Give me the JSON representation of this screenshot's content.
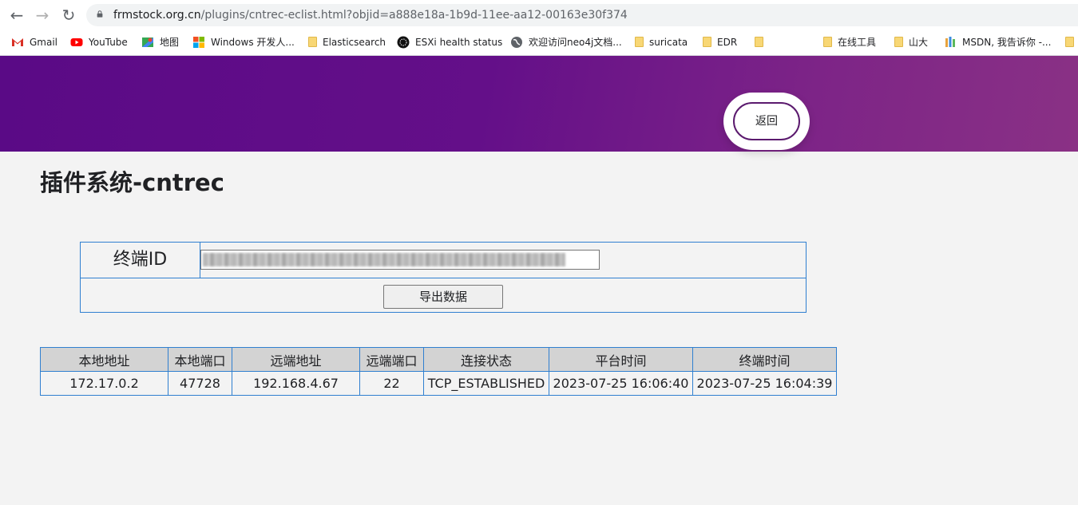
{
  "browser": {
    "url_host": "frmstock.org.cn",
    "url_path": "/plugins/cntrec-eclist.html?objid=a888e18a-1b9d-11ee-aa12-00163e30f374",
    "bookmarks": [
      {
        "label": "Gmail",
        "icon": "gmail-icon"
      },
      {
        "label": "YouTube",
        "icon": "youtube-icon"
      },
      {
        "label": "地图",
        "icon": "maps-icon"
      },
      {
        "label": "Windows 开发人...",
        "icon": "windows-icon"
      },
      {
        "label": "Elasticsearch",
        "icon": "folder-icon"
      },
      {
        "label": "ESXi health status",
        "icon": "esxi-icon"
      },
      {
        "label": "欢迎访问neo4j文档...",
        "icon": "globe-icon"
      },
      {
        "label": "suricata",
        "icon": "folder-icon"
      },
      {
        "label": "EDR",
        "icon": "folder-icon"
      },
      {
        "label": "",
        "icon": "folder-icon"
      },
      {
        "label": "在线工具",
        "icon": "folder-icon"
      },
      {
        "label": "山大",
        "icon": "folder-icon"
      },
      {
        "label": "MSDN, 我告诉你 -...",
        "icon": "msdn-icon"
      },
      {
        "label": "",
        "icon": "folder-icon"
      }
    ]
  },
  "header": {
    "back_label": "返回",
    "gradient_colors": [
      "#5a0a86",
      "#8a3185"
    ]
  },
  "page": {
    "title": "插件系统-cntrec"
  },
  "form": {
    "id_label": "终端ID",
    "id_value": "",
    "export_label": "导出数据"
  },
  "table": {
    "headers": [
      "本地地址",
      "本地端口",
      "远端地址",
      "远端端口",
      "连接状态",
      "平台时间",
      "终端时间"
    ],
    "rows": [
      [
        "172.17.0.2",
        "47728",
        "192.168.4.67",
        "22",
        "TCP_ESTABLISHED",
        "2023-07-25 16:06:40",
        "2023-07-25 16:04:39"
      ]
    ]
  }
}
